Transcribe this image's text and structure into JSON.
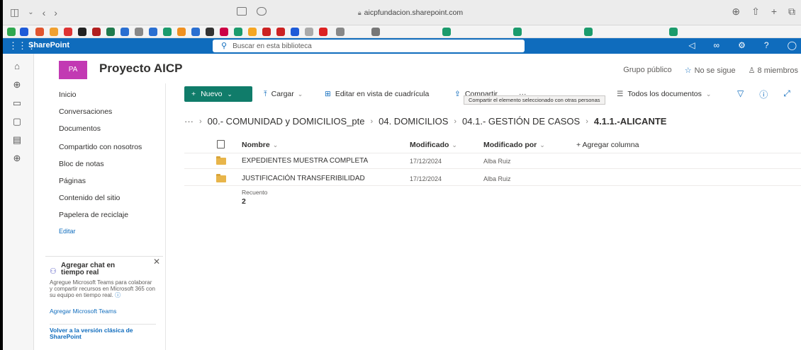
{
  "browser": {
    "address": "aicpfundacion.sharepoint.com"
  },
  "suitebar": {
    "app_name": "SharePoint",
    "search_placeholder": "Buscar en esta biblioteca"
  },
  "site": {
    "logo_initials": "PA",
    "title": "Proyecto AICP",
    "group_type": "Grupo público",
    "follow_label": "No se sigue",
    "members_label": "8 miembros"
  },
  "nav": {
    "items": [
      "Inicio",
      "Conversaciones",
      "Documentos",
      "Compartido con nosotros",
      "Bloc de notas",
      "Páginas",
      "Contenido del sitio",
      "Papelera de reciclaje"
    ],
    "edit_label": "Editar"
  },
  "teams_card": {
    "title": "Agregar chat en tiempo real",
    "description": "Agregue Microsoft Teams para colaborar y compartir recursos en Microsoft 365 con su equipo en tiempo real.",
    "link": "Agregar Microsoft Teams"
  },
  "classic_link": "Volver a la versión clásica de SharePoint",
  "commandbar": {
    "new_label": "Nuevo",
    "upload_label": "Cargar",
    "grid_edit_label": "Editar en vista de cuadrícula",
    "share_label": "Compartir",
    "more_label": "···",
    "tooltip": "Compartir el elemento seleccionado con otras personas",
    "view_label": "Todos los documentos"
  },
  "breadcrumb": {
    "ellipsis": "···",
    "items": [
      "00.- COMUNIDAD y DOMICILIOS_pte",
      "04. DOMICILIOS",
      "04.1.- GESTIÓN DE CASOS",
      "4.1.1.-ALICANTE"
    ]
  },
  "table": {
    "columns": {
      "name": "Nombre",
      "modified": "Modificado",
      "modified_by": "Modificado por",
      "add_column": "+ Agregar columna"
    },
    "rows": [
      {
        "name": "EXPEDIENTES MUESTRA COMPLETA",
        "modified": "17/12/2024",
        "modified_by": "Alba Ruiz"
      },
      {
        "name": "JUSTIFICACIÓN TRANSFERIBILIDAD",
        "modified": "17/12/2024",
        "modified_by": "Alba Ruiz"
      }
    ],
    "count_label": "Recuento",
    "count_value": "2"
  },
  "colors": {
    "suite_blue": "#0f6cbd",
    "new_button_green": "#107c6a",
    "site_logo_magenta": "#c239b3",
    "folder_yellow": "#e8b54a"
  }
}
